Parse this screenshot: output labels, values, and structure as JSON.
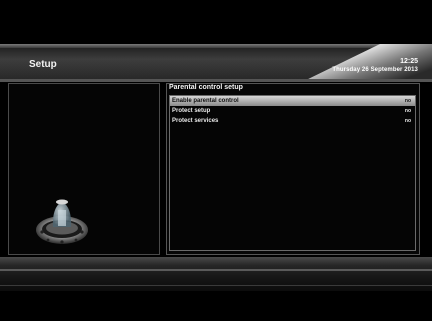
{
  "header": {
    "title": "Setup",
    "time": "12:25",
    "date": "Thursday 26 September 2013"
  },
  "panel": {
    "heading": "Parental control setup",
    "items": [
      {
        "label": "Enable parental control",
        "value": "no",
        "selected": true
      },
      {
        "label": "Protect setup",
        "value": "no",
        "selected": false
      },
      {
        "label": "Protect services",
        "value": "no",
        "selected": false
      }
    ]
  },
  "colors": {
    "background": "#000000",
    "selection": "#c8c8c8",
    "text": "#f0f0f0"
  },
  "icons": {
    "illustration": "satellite-receiver-dish-icon"
  }
}
